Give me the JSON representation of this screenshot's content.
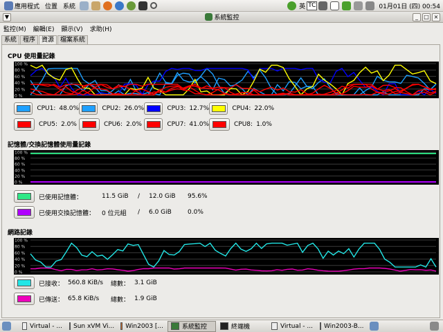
{
  "topbar": {
    "menu_apps": "應用程式",
    "menu_places": "位置",
    "menu_system": "系統",
    "ime": "英",
    "ime_tc": "TC",
    "clock": "01月01日 (四) 00:54"
  },
  "window": {
    "title": "系統監控",
    "menus": [
      "監控(M)",
      "編輯(E)",
      "顯示(V)",
      "求助(H)"
    ],
    "tabs": [
      "系統",
      "程序",
      "資源",
      "檔案系統"
    ],
    "active_tab": "資源"
  },
  "cpu": {
    "title": "CPU 使用量記錄",
    "yticks": [
      "100 %",
      "80 %",
      "60 %",
      "40 %",
      "20 %",
      "0 %"
    ],
    "legend": [
      {
        "label": "CPU1:",
        "value": "48.0%",
        "color": "#1ea0ff"
      },
      {
        "label": "CPU2:",
        "value": "26.0%",
        "color": "#1ea0ff"
      },
      {
        "label": "CPU3:",
        "value": "12.7%",
        "color": "#0000ff"
      },
      {
        "label": "CPU4:",
        "value": "22.0%",
        "color": "#ffff00"
      },
      {
        "label": "CPU5:",
        "value": "2.0%",
        "color": "#ff0000"
      },
      {
        "label": "CPU6:",
        "value": "2.0%",
        "color": "#ff0000"
      },
      {
        "label": "CPU7:",
        "value": "41.0%",
        "color": "#ff0000"
      },
      {
        "label": "CPU8:",
        "value": "1.0%",
        "color": "#ff0000"
      }
    ]
  },
  "memory": {
    "title": "記憶體/交換記憶體使用量記錄",
    "yticks": [
      "100 %",
      "80 %",
      "60 %",
      "40 %",
      "20 %",
      "0 %"
    ],
    "mem_label": "已使用記憶體：",
    "mem_used": "11.5 GiB",
    "mem_sep": "/",
    "mem_total": "12.0 GiB",
    "mem_pct": "95.6%",
    "mem_color": "#2ee886",
    "swap_label": "已使用交換記憶體：",
    "swap_used": "0 位元組",
    "swap_sep": "/",
    "swap_total": "6.0 GiB",
    "swap_pct": "0.0%",
    "swap_color": "#b000ff"
  },
  "network": {
    "title": "網路記錄",
    "yticks": [
      "100 %",
      "80 %",
      "60 %",
      "40 %",
      "20 %",
      "0 %"
    ],
    "recv_label": "已接收：",
    "recv_rate": "560.8 KiB/s",
    "recv_total_label": "總數：",
    "recv_total": "3.1 GiB",
    "recv_color": "#22e6e6",
    "sent_label": "已傳送：",
    "sent_rate": "65.8 KiB/s",
    "sent_total_label": "總數：",
    "sent_total": "1.9 GiB",
    "sent_color": "#ee00bb"
  },
  "taskbar": {
    "tasks": [
      "Virtual - ...",
      "Sun xVM Vi...",
      "Win2003 [...",
      "系統監控",
      "終端機",
      "Virtual - ...",
      "Win2003-B..."
    ],
    "active": "系統監控"
  }
}
